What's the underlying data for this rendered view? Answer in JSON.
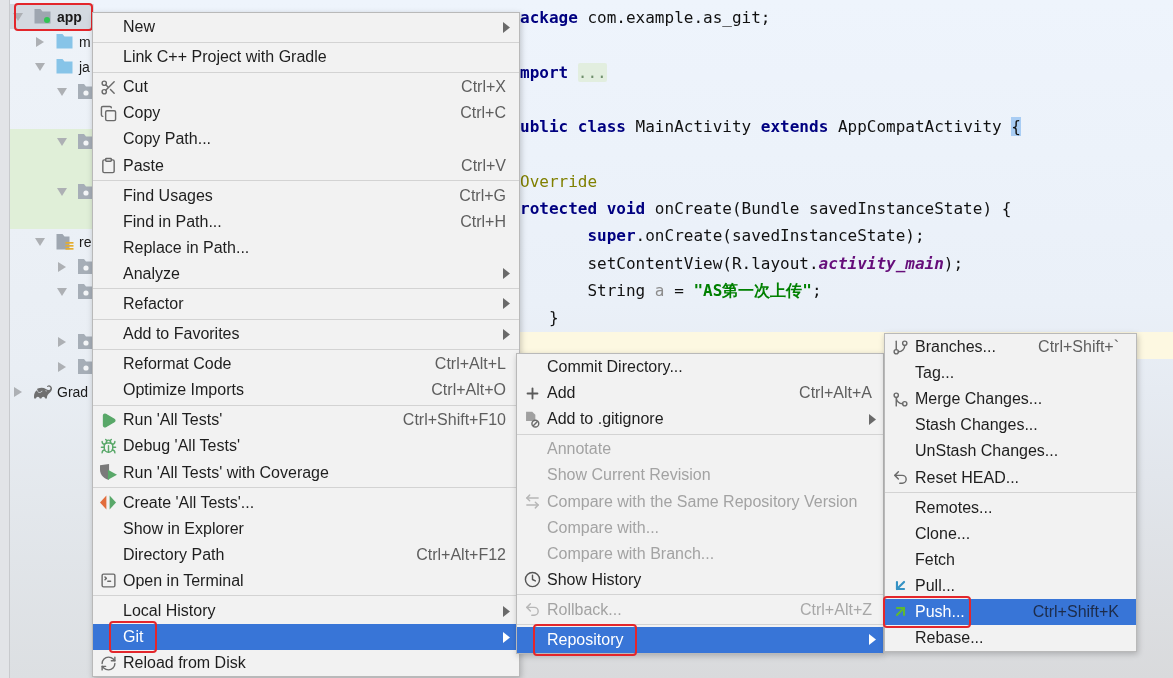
{
  "project_tree": {
    "nodes": [
      {
        "label": "app",
        "kind": "module",
        "expanded": true,
        "selected": true,
        "highlighted": false,
        "annotated": true,
        "children": [
          {
            "label": "m",
            "kind": "folder",
            "expanded": false,
            "selected": false,
            "highlighted": false,
            "annotated": false
          },
          {
            "label": "ja",
            "kind": "folder",
            "expanded": true,
            "selected": false,
            "highlighted": false,
            "annotated": false,
            "children": [
              {
                "kind": "package",
                "expanded": true,
                "selected": false,
                "highlighted": false,
                "annotated": false
              },
              {
                "kind": "package",
                "expanded": true,
                "selected": false,
                "highlighted": true,
                "annotated": false
              },
              {
                "kind": "package",
                "expanded": true,
                "selected": false,
                "highlighted": true,
                "annotated": false
              }
            ]
          },
          {
            "label": "re",
            "kind": "resources",
            "expanded": true,
            "selected": false,
            "highlighted": false,
            "annotated": false,
            "children": [
              {
                "kind": "package",
                "expanded": false,
                "selected": false,
                "highlighted": false,
                "annotated": false
              },
              {
                "kind": "package",
                "expanded": true,
                "selected": false,
                "highlighted": false,
                "annotated": false
              },
              {
                "kind": "package",
                "expanded": false,
                "selected": false,
                "highlighted": false,
                "annotated": false
              },
              {
                "kind": "package",
                "expanded": false,
                "selected": false,
                "highlighted": false,
                "annotated": false
              }
            ]
          }
        ]
      },
      {
        "label": "Grad",
        "kind": "gradle",
        "expanded": false,
        "selected": false,
        "highlighted": false,
        "annotated": false
      }
    ]
  },
  "editor": {
    "lines": [
      {
        "kind": "top",
        "current": false,
        "tokens": [
          {
            "text": "ackage",
            "kind": "keyword"
          },
          {
            "text": " com.example.as_git;",
            "kind": "plain"
          }
        ]
      },
      {
        "kind": "blank",
        "current": false
      },
      {
        "kind": "top",
        "current": false,
        "tokens": [
          {
            "text": "mport ",
            "kind": "keyword"
          },
          {
            "text": "...",
            "kind": "fold"
          }
        ]
      },
      {
        "kind": "blank",
        "current": false
      },
      {
        "kind": "top",
        "current": false,
        "tokens": [
          {
            "text": "ublic class",
            "kind": "keyword"
          },
          {
            "text": " MainActivity ",
            "kind": "plain"
          },
          {
            "text": "extends",
            "kind": "keyword"
          },
          {
            "text": " AppCompatActivity ",
            "kind": "plain"
          },
          {
            "text": "{",
            "kind": "brace_match"
          }
        ]
      },
      {
        "kind": "blank",
        "current": false
      },
      {
        "kind": "top",
        "current": false,
        "tokens": [
          {
            "text": "Override",
            "kind": "annotation"
          }
        ]
      },
      {
        "kind": "top",
        "current": false,
        "tokens": [
          {
            "text": "rotected void",
            "kind": "keyword"
          },
          {
            "text": " onCreate(Bundle savedInstanceState) {",
            "kind": "plain"
          }
        ]
      },
      {
        "kind": "body",
        "current": false,
        "tokens": [
          {
            "text": "super",
            "kind": "keyword"
          },
          {
            "text": ".onCreate(savedInstanceState);",
            "kind": "plain"
          }
        ]
      },
      {
        "kind": "body",
        "current": false,
        "tokens": [
          {
            "text": "setContentView(R.layout.",
            "kind": "plain"
          },
          {
            "text": "activity_main",
            "kind": "field"
          },
          {
            "text": ");",
            "kind": "plain"
          }
        ]
      },
      {
        "kind": "body",
        "current": false,
        "tokens": [
          {
            "text": "String ",
            "kind": "plain"
          },
          {
            "text": "a",
            "kind": "unused"
          },
          {
            "text": " = ",
            "kind": "plain"
          },
          {
            "text": "\"AS第一次上传\"",
            "kind": "string"
          },
          {
            "text": ";",
            "kind": "plain"
          }
        ]
      },
      {
        "kind": "close",
        "current": false,
        "tokens": [
          {
            "text": "}",
            "kind": "plain"
          }
        ]
      },
      {
        "kind": "blank",
        "current": true
      }
    ]
  },
  "context_menu": {
    "groups": [
      [
        {
          "label": "New",
          "submenu": true,
          "selected": false,
          "annotated": false
        }
      ],
      [
        {
          "label": "Link C++ Project with Gradle",
          "submenu": false,
          "selected": false,
          "annotated": false
        }
      ],
      [
        {
          "label": "Cut",
          "shortcut": "Ctrl+X",
          "submenu": false,
          "selected": false,
          "annotated": false
        },
        {
          "label": "Copy",
          "shortcut": "Ctrl+C",
          "submenu": false,
          "selected": false,
          "annotated": false
        },
        {
          "label": "Copy Path...",
          "submenu": false,
          "selected": false,
          "annotated": false
        },
        {
          "label": "Paste",
          "shortcut": "Ctrl+V",
          "submenu": false,
          "selected": false,
          "annotated": false
        }
      ],
      [
        {
          "label": "Find Usages",
          "shortcut": "Ctrl+G",
          "submenu": false,
          "selected": false,
          "annotated": false
        },
        {
          "label": "Find in Path...",
          "shortcut": "Ctrl+H",
          "submenu": false,
          "selected": false,
          "annotated": false
        },
        {
          "label": "Replace in Path...",
          "submenu": false,
          "selected": false,
          "annotated": false
        },
        {
          "label": "Analyze",
          "submenu": true,
          "selected": false,
          "annotated": false
        }
      ],
      [
        {
          "label": "Refactor",
          "submenu": true,
          "selected": false,
          "annotated": false
        }
      ],
      [
        {
          "label": "Add to Favorites",
          "submenu": true,
          "selected": false,
          "annotated": false
        }
      ],
      [
        {
          "label": "Reformat Code",
          "shortcut": "Ctrl+Alt+L",
          "submenu": false,
          "selected": false,
          "annotated": false
        },
        {
          "label": "Optimize Imports",
          "shortcut": "Ctrl+Alt+O",
          "submenu": false,
          "selected": false,
          "annotated": false
        }
      ],
      [
        {
          "label": "Run 'All Tests'",
          "shortcut": "Ctrl+Shift+F10",
          "submenu": false,
          "selected": false,
          "annotated": false
        },
        {
          "label": "Debug 'All Tests'",
          "submenu": false,
          "selected": false,
          "annotated": false
        },
        {
          "label": "Run 'All Tests' with Coverage",
          "submenu": false,
          "selected": false,
          "annotated": false
        }
      ],
      [
        {
          "label": "Create 'All Tests'...",
          "submenu": false,
          "selected": false,
          "annotated": false
        },
        {
          "label": "Show in Explorer",
          "submenu": false,
          "selected": false,
          "annotated": false
        },
        {
          "label": "Directory Path",
          "shortcut": "Ctrl+Alt+F12",
          "submenu": false,
          "selected": false,
          "annotated": false
        },
        {
          "label": "Open in Terminal",
          "submenu": false,
          "selected": false,
          "annotated": false
        }
      ],
      [
        {
          "label": "Local History",
          "submenu": true,
          "selected": false,
          "annotated": false
        },
        {
          "label": "Git",
          "submenu": true,
          "selected": true,
          "annotated": true
        },
        {
          "label": "Reload from Disk",
          "submenu": false,
          "selected": false,
          "annotated": false
        }
      ]
    ]
  },
  "git_submenu": {
    "groups": [
      [
        {
          "label": "Commit Directory...",
          "submenu": false,
          "selected": false,
          "disabled": false,
          "annotated": false
        },
        {
          "label": "Add",
          "shortcut": "Ctrl+Alt+A",
          "submenu": false,
          "selected": false,
          "disabled": false,
          "annotated": false
        },
        {
          "label": "Add to .gitignore",
          "submenu": true,
          "selected": false,
          "disabled": false,
          "annotated": false
        }
      ],
      [
        {
          "label": "Annotate",
          "submenu": false,
          "selected": false,
          "disabled": true,
          "annotated": false
        },
        {
          "label": "Show Current Revision",
          "submenu": false,
          "selected": false,
          "disabled": true,
          "annotated": false
        },
        {
          "label": "Compare with the Same Repository Version",
          "submenu": false,
          "selected": false,
          "disabled": true,
          "annotated": false
        },
        {
          "label": "Compare with...",
          "submenu": false,
          "selected": false,
          "disabled": true,
          "annotated": false
        },
        {
          "label": "Compare with Branch...",
          "submenu": false,
          "selected": false,
          "disabled": true,
          "annotated": false
        },
        {
          "label": "Show History",
          "submenu": false,
          "selected": false,
          "disabled": false,
          "annotated": false
        }
      ],
      [
        {
          "label": "Rollback...",
          "shortcut": "Ctrl+Alt+Z",
          "submenu": false,
          "selected": false,
          "disabled": true,
          "annotated": false
        }
      ],
      [
        {
          "label": "Repository",
          "submenu": true,
          "selected": true,
          "disabled": false,
          "annotated": true
        }
      ]
    ]
  },
  "repository_submenu": {
    "groups": [
      [
        {
          "label": "Branches...",
          "shortcut": "Ctrl+Shift+`",
          "submenu": false,
          "selected": false,
          "annotated": false
        },
        {
          "label": "Tag...",
          "submenu": false,
          "selected": false,
          "annotated": false
        },
        {
          "label": "Merge Changes...",
          "submenu": false,
          "selected": false,
          "annotated": false
        },
        {
          "label": "Stash Changes...",
          "submenu": false,
          "selected": false,
          "annotated": false
        },
        {
          "label": "UnStash Changes...",
          "submenu": false,
          "selected": false,
          "annotated": false
        },
        {
          "label": "Reset HEAD...",
          "submenu": false,
          "selected": false,
          "annotated": false
        }
      ],
      [
        {
          "label": "Remotes...",
          "submenu": false,
          "selected": false,
          "annotated": false
        },
        {
          "label": "Clone...",
          "submenu": false,
          "selected": false,
          "annotated": false
        },
        {
          "label": "Fetch",
          "submenu": false,
          "selected": false,
          "annotated": false
        },
        {
          "label": "Pull...",
          "submenu": false,
          "selected": false,
          "annotated": false
        },
        {
          "label": "Push...",
          "shortcut": "Ctrl+Shift+K",
          "submenu": false,
          "selected": true,
          "annotated": true
        },
        {
          "label": "Rebase...",
          "submenu": false,
          "selected": false,
          "annotated": false
        }
      ]
    ]
  }
}
